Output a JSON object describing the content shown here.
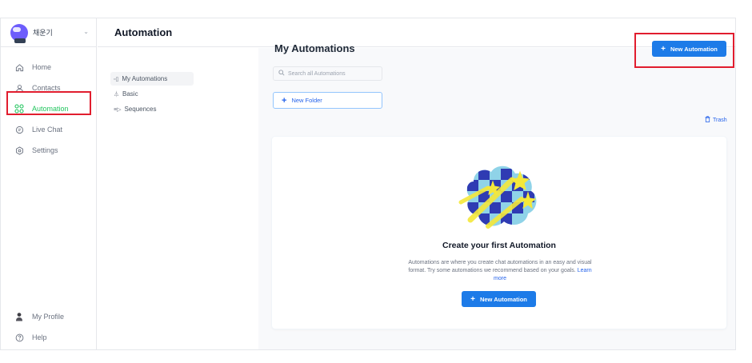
{
  "account": {
    "name": "채운기"
  },
  "header": {
    "title": "Automation"
  },
  "nav": {
    "items": [
      {
        "label": "Home",
        "icon": "home-icon"
      },
      {
        "label": "Contacts",
        "icon": "contacts-icon"
      },
      {
        "label": "Automation",
        "icon": "automation-icon",
        "active": true
      },
      {
        "label": "Live Chat",
        "icon": "chat-icon"
      },
      {
        "label": "Settings",
        "icon": "settings-icon"
      }
    ],
    "bottom": [
      {
        "label": "My Profile",
        "icon": "profile-icon"
      },
      {
        "label": "Help",
        "icon": "help-icon"
      }
    ]
  },
  "subnav": {
    "items": [
      {
        "label": "My Automations",
        "icon": "my-automations-icon",
        "active": true
      },
      {
        "label": "Basic",
        "icon": "basic-icon"
      },
      {
        "label": "Sequences",
        "icon": "sequences-icon"
      }
    ]
  },
  "main": {
    "title": "My Automations",
    "search_placeholder": "Search all Automations",
    "new_folder_label": "New Folder",
    "new_automation_label": "New Automation",
    "trash_label": "Trash"
  },
  "empty_state": {
    "title": "Create your first Automation",
    "description": "Automations are where you create chat automations in an easy and visual format. Try some automations we recommend based on your goals.",
    "learn_more": "Learn more",
    "button_label": "New Automation"
  },
  "colors": {
    "accent": "#1d7be8",
    "active_nav": "#22c55e",
    "highlight": "#e11d2e"
  }
}
